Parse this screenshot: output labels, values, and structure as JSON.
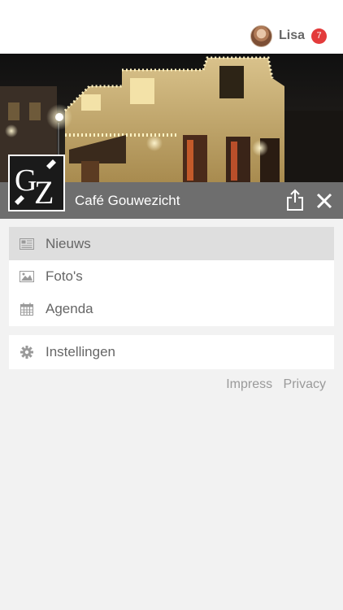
{
  "user": {
    "name": "Lisa",
    "notification_count": "7"
  },
  "venue": {
    "name": "Café Gouwezicht",
    "logo_text": "GZ"
  },
  "menu": {
    "items": [
      {
        "label": "Nieuws",
        "icon": "newspaper-icon",
        "selected": true
      },
      {
        "label": "Foto's",
        "icon": "image-icon",
        "selected": false
      },
      {
        "label": "Agenda",
        "icon": "calendar-icon",
        "selected": false
      }
    ],
    "settings": {
      "label": "Instellingen",
      "icon": "gear-icon"
    }
  },
  "footer": {
    "impress": "Impress",
    "privacy": "Privacy"
  },
  "colors": {
    "background": "#f2f2f2",
    "venue_bar": "#6e6e6e",
    "selected_item": "#dedede",
    "badge": "#e33b3b",
    "text_muted": "#666666",
    "footer_text": "#9a9a9a"
  }
}
